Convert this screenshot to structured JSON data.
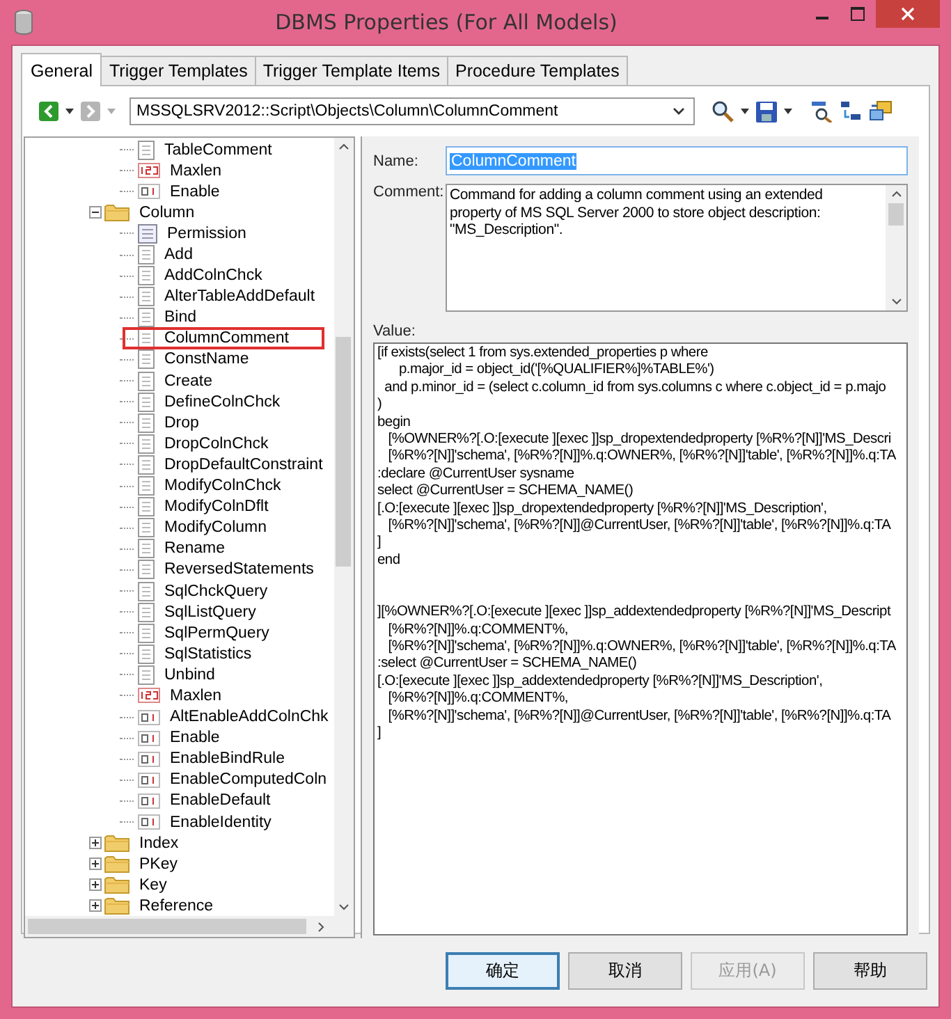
{
  "window": {
    "title": "DBMS Properties (For All Models)"
  },
  "tabs": [
    {
      "label": "General",
      "selected": true
    },
    {
      "label": "Trigger Templates",
      "selected": false
    },
    {
      "label": "Trigger Template Items",
      "selected": false
    },
    {
      "label": "Procedure Templates",
      "selected": false
    }
  ],
  "toolbar": {
    "back_disabled": false,
    "forward_disabled": true,
    "path": "MSSQLSRV2012::Script\\Objects\\Column\\ColumnComment"
  },
  "tree": {
    "continued_items": [
      {
        "label": "TableComment",
        "kind": "script",
        "selected": false
      },
      {
        "label": "Maxlen",
        "kind": "number",
        "selected": false
      },
      {
        "label": "Enable",
        "kind": "boolean",
        "selected": false
      }
    ],
    "folders": [
      {
        "label": "Column",
        "expanded": true,
        "children": [
          {
            "label": "Permission",
            "kind": "list",
            "selected": false
          },
          {
            "label": "Add",
            "kind": "script",
            "selected": false
          },
          {
            "label": "AddColnChck",
            "kind": "script",
            "selected": false
          },
          {
            "label": "AlterTableAddDefault",
            "kind": "script",
            "selected": false
          },
          {
            "label": "Bind",
            "kind": "script",
            "selected": false
          },
          {
            "label": "ColumnComment",
            "kind": "script",
            "selected": true
          },
          {
            "label": "ConstName",
            "kind": "script",
            "selected": false
          },
          {
            "label": "Create",
            "kind": "script",
            "selected": false
          },
          {
            "label": "DefineColnChck",
            "kind": "script",
            "selected": false
          },
          {
            "label": "Drop",
            "kind": "script",
            "selected": false
          },
          {
            "label": "DropColnChck",
            "kind": "script",
            "selected": false
          },
          {
            "label": "DropDefaultConstraint",
            "kind": "script",
            "selected": false
          },
          {
            "label": "ModifyColnChck",
            "kind": "script",
            "selected": false
          },
          {
            "label": "ModifyColnDflt",
            "kind": "script",
            "selected": false
          },
          {
            "label": "ModifyColumn",
            "kind": "script",
            "selected": false
          },
          {
            "label": "Rename",
            "kind": "script",
            "selected": false
          },
          {
            "label": "ReversedStatements",
            "kind": "script",
            "selected": false
          },
          {
            "label": "SqlChckQuery",
            "kind": "script",
            "selected": false
          },
          {
            "label": "SqlListQuery",
            "kind": "script",
            "selected": false
          },
          {
            "label": "SqlPermQuery",
            "kind": "script",
            "selected": false
          },
          {
            "label": "SqlStatistics",
            "kind": "script",
            "selected": false
          },
          {
            "label": "Unbind",
            "kind": "script",
            "selected": false
          },
          {
            "label": "Maxlen",
            "kind": "number",
            "selected": false
          },
          {
            "label": "AltEnableAddColnChk",
            "kind": "boolean",
            "selected": false
          },
          {
            "label": "Enable",
            "kind": "boolean",
            "selected": false
          },
          {
            "label": "EnableBindRule",
            "kind": "boolean",
            "selected": false
          },
          {
            "label": "EnableComputedColn",
            "kind": "boolean",
            "selected": false
          },
          {
            "label": "EnableDefault",
            "kind": "boolean",
            "selected": false
          },
          {
            "label": "EnableIdentity",
            "kind": "boolean",
            "selected": false
          }
        ]
      },
      {
        "label": "Index",
        "expanded": false
      },
      {
        "label": "PKey",
        "expanded": false
      },
      {
        "label": "Key",
        "expanded": false
      },
      {
        "label": "Reference",
        "expanded": false
      }
    ]
  },
  "form": {
    "name_label": "Name:",
    "name_value": "ColumnComment",
    "name_selected": true,
    "comment_label": "Comment:",
    "comment": "Command for adding a column comment using an extended property of MS SQL Server 2000 to store object description: \"MS_Description\".",
    "value_label": "Value:",
    "value": "[if exists(select 1 from sys.extended_properties p where\n      p.major_id = object_id('[%QUALIFIER%]%TABLE%')\n  and p.minor_id = (select c.column_id from sys.columns c where c.object_id = p.majo\n)\nbegin\n   [%OWNER%?[.O:[execute ][exec ]]sp_dropextendedproperty [%R%?[N]]'MS_Descri\n   [%R%?[N]]'schema', [%R%?[N]]%.q:OWNER%, [%R%?[N]]'table', [%R%?[N]]%.q:TA\n:declare @CurrentUser sysname\nselect @CurrentUser = SCHEMA_NAME()\n[.O:[execute ][exec ]]sp_dropextendedproperty [%R%?[N]]'MS_Description',\n   [%R%?[N]]'schema', [%R%?[N]]@CurrentUser, [%R%?[N]]'table', [%R%?[N]]%.q:TA\n]\nend\n\n\n][%OWNER%?[.O:[execute ][exec ]]sp_addextendedproperty [%R%?[N]]'MS_Descript\n   [%R%?[N]]%.q:COMMENT%,\n   [%R%?[N]]'schema', [%R%?[N]]%.q:OWNER%, [%R%?[N]]'table', [%R%?[N]]%.q:TA\n:select @CurrentUser = SCHEMA_NAME()\n[.O:[execute ][exec ]]sp_addextendedproperty [%R%?[N]]'MS_Description',\n   [%R%?[N]]%.q:COMMENT%,\n   [%R%?[N]]'schema', [%R%?[N]]@CurrentUser, [%R%?[N]]'table', [%R%?[N]]%.q:TA\n]"
  },
  "buttons": [
    {
      "label": "确定",
      "default": true,
      "disabled": false
    },
    {
      "label": "取消",
      "default": false,
      "disabled": false
    },
    {
      "label": "应用(A)",
      "default": false,
      "disabled": true
    },
    {
      "label": "帮助",
      "default": false,
      "disabled": false
    }
  ]
}
